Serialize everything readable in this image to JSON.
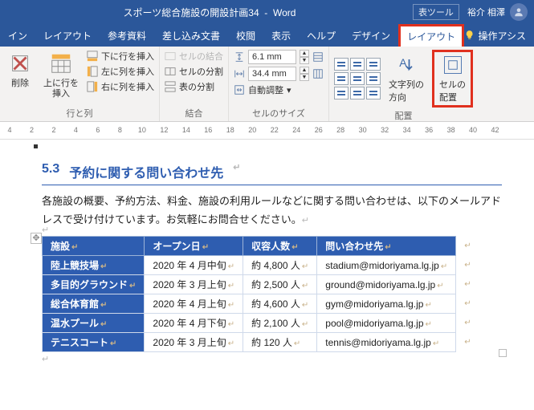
{
  "titlebar": {
    "document_title": "スポーツ総合施設の開設計画34",
    "app_name": "Word",
    "context_tab_group": "表ツール",
    "user_name": "裕介 相澤"
  },
  "tabs": {
    "items": [
      "イン",
      "レイアウト",
      "参考資料",
      "差し込み文書",
      "校閲",
      "表示",
      "ヘルプ",
      "デザイン",
      "レイアウト"
    ],
    "tell_me": "操作アシス"
  },
  "ribbon": {
    "group_rows_cols": {
      "delete": "削除",
      "insert_above": "上に行を\n挿入",
      "insert_below": "下に行を挿入",
      "insert_left": "左に列を挿入",
      "insert_right": "右に列を挿入",
      "label": "行と列"
    },
    "group_merge": {
      "merge_cells": "セルの結合",
      "split_cells": "セルの分割",
      "split_table": "表の分割",
      "label": "結合"
    },
    "group_cell_size": {
      "height_value": "6.1 mm",
      "width_value": "34.4 mm",
      "autofit": "自動調整",
      "label": "セルのサイズ"
    },
    "group_align": {
      "text_direction": "文字列の\n方向",
      "cell_margins": "セルの\n配置",
      "label": "配置"
    }
  },
  "ruler": {
    "numbers": [
      -4,
      -2,
      2,
      4,
      6,
      8,
      10,
      12,
      14,
      16,
      18,
      20,
      22,
      24,
      26,
      28,
      30,
      32,
      34,
      36,
      38,
      40,
      42
    ]
  },
  "document": {
    "heading_number": "5.3",
    "heading_text": "予約に関する問い合わせ先",
    "body": "各施設の概要、予約方法、料金、施設の利用ルールなどに関する問い合わせは、以下のメールアドレスで受け付けています。お気軽にお問合せください。",
    "table": {
      "headers": [
        "施設",
        "オープン日",
        "収容人数",
        "問い合わせ先"
      ],
      "rows": [
        {
          "facility": "陸上競技場",
          "open": "2020 年 4 月中旬",
          "capacity": "約 4,800 人",
          "contact": "stadium@midoriyama.lg.jp"
        },
        {
          "facility": "多目的グラウンド",
          "open": "2020 年 3 月上旬",
          "capacity": "約 2,500 人",
          "contact": "ground@midoriyama.lg.jp"
        },
        {
          "facility": "総合体育館",
          "open": "2020 年 4 月上旬",
          "capacity": "約 4,600 人",
          "contact": "gym@midoriyama.lg.jp"
        },
        {
          "facility": "温水プール",
          "open": "2020 年 4 月下旬",
          "capacity": "約 2,100 人",
          "contact": "pool@midoriyama.lg.jp"
        },
        {
          "facility": "テニスコート",
          "open": "2020 年 3 月上旬",
          "capacity": "約 120 人",
          "contact": "tennis@midoriyama.lg.jp"
        }
      ]
    }
  }
}
